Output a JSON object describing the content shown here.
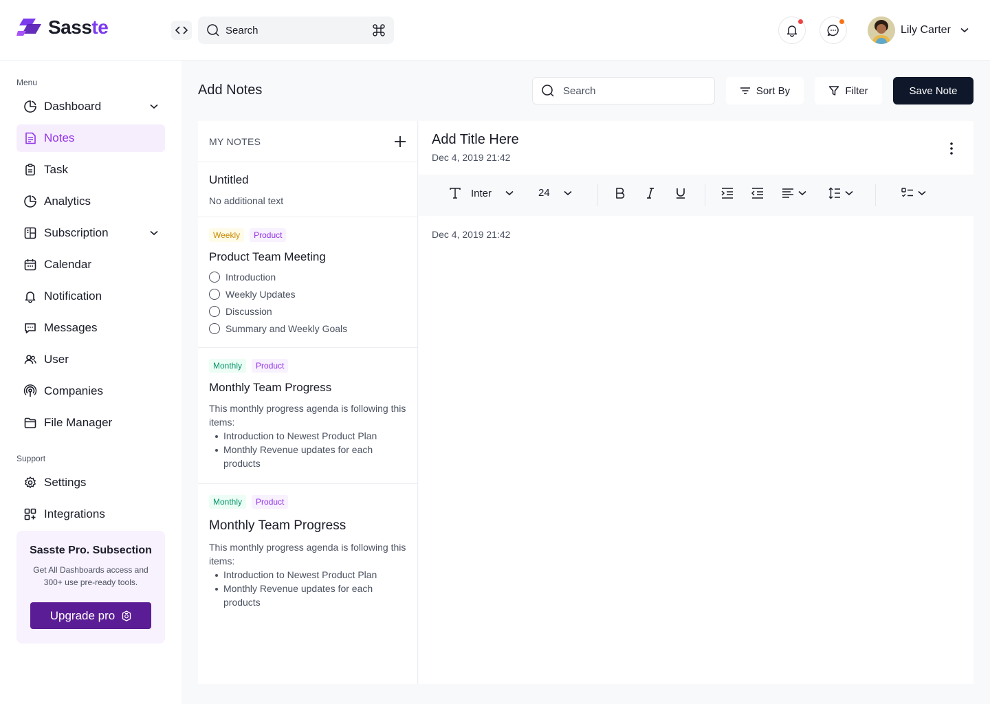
{
  "brand": {
    "name_part1": "Sass",
    "name_part2": "te",
    "accent_color": "#7c3aed"
  },
  "topbar": {
    "search_placeholder": "Search",
    "shortcut_icon": "command-icon",
    "notification_dot_color": "#ef4444",
    "message_dot_color": "#f97316",
    "user_name": "Lily Carter"
  },
  "sidebar": {
    "menu_label": "Menu",
    "items": [
      {
        "label": "Dashboard",
        "icon": "chart-pie-icon",
        "has_chevron": true
      },
      {
        "label": "Notes",
        "icon": "note-icon",
        "active": true
      },
      {
        "label": "Task",
        "icon": "clipboard-icon"
      },
      {
        "label": "Analytics",
        "icon": "chart-pie-icon"
      },
      {
        "label": "Subscription",
        "icon": "layout-icon",
        "has_chevron": true
      },
      {
        "label": "Calendar",
        "icon": "calendar-icon"
      },
      {
        "label": "Notification",
        "icon": "bell-icon"
      },
      {
        "label": "Messages",
        "icon": "message-icon"
      },
      {
        "label": "User",
        "icon": "users-icon"
      },
      {
        "label": "Companies",
        "icon": "broadcast-icon"
      },
      {
        "label": "File Manager",
        "icon": "folder-icon"
      }
    ],
    "support_label": "Support",
    "support_items": [
      {
        "label": "Settings",
        "icon": "gear-icon"
      },
      {
        "label": "Integrations",
        "icon": "grid-plus-icon"
      }
    ],
    "promo": {
      "title": "Sasste Pro. Subsection",
      "subtitle": "Get All Dashboards access and 300+ use pre-ready tools.",
      "button": "Upgrade pro"
    }
  },
  "main": {
    "title": "Add Notes",
    "search_placeholder": "Search",
    "sort_label": "Sort By",
    "filter_label": "Filter",
    "save_label": "Save Note"
  },
  "notes": {
    "header": "MY NOTES",
    "untitled": {
      "title": "Untitled",
      "subtitle": "No additional text"
    },
    "meeting": {
      "tags": [
        "Weekly",
        "Product"
      ],
      "title": "Product Team Meeting",
      "checklist": [
        "Introduction",
        "Weekly Updates",
        "Discussion",
        "Summary and Weekly Goals"
      ]
    },
    "progress1": {
      "tags": [
        "Monthly",
        "Product"
      ],
      "title": "Monthly Team Progress",
      "text": "This monthly progress agenda is following this items:",
      "bullets": [
        "Introduction to Newest Product Plan",
        "Monthly Revenue updates for each products"
      ]
    },
    "progress2": {
      "tags": [
        "Monthly",
        "Product"
      ],
      "title": "Monthly Team Progress",
      "text": "This monthly progress agenda is following this items:",
      "bullets": [
        "Introduction to Newest Product Plan",
        "Monthly Revenue updates for each products"
      ]
    }
  },
  "editor": {
    "title": "Add Title Here",
    "date": "Dec 4, 2019 21:42",
    "font_name": "Inter",
    "font_size": "24",
    "body_text": "Dec 4, 2019 21:42"
  }
}
